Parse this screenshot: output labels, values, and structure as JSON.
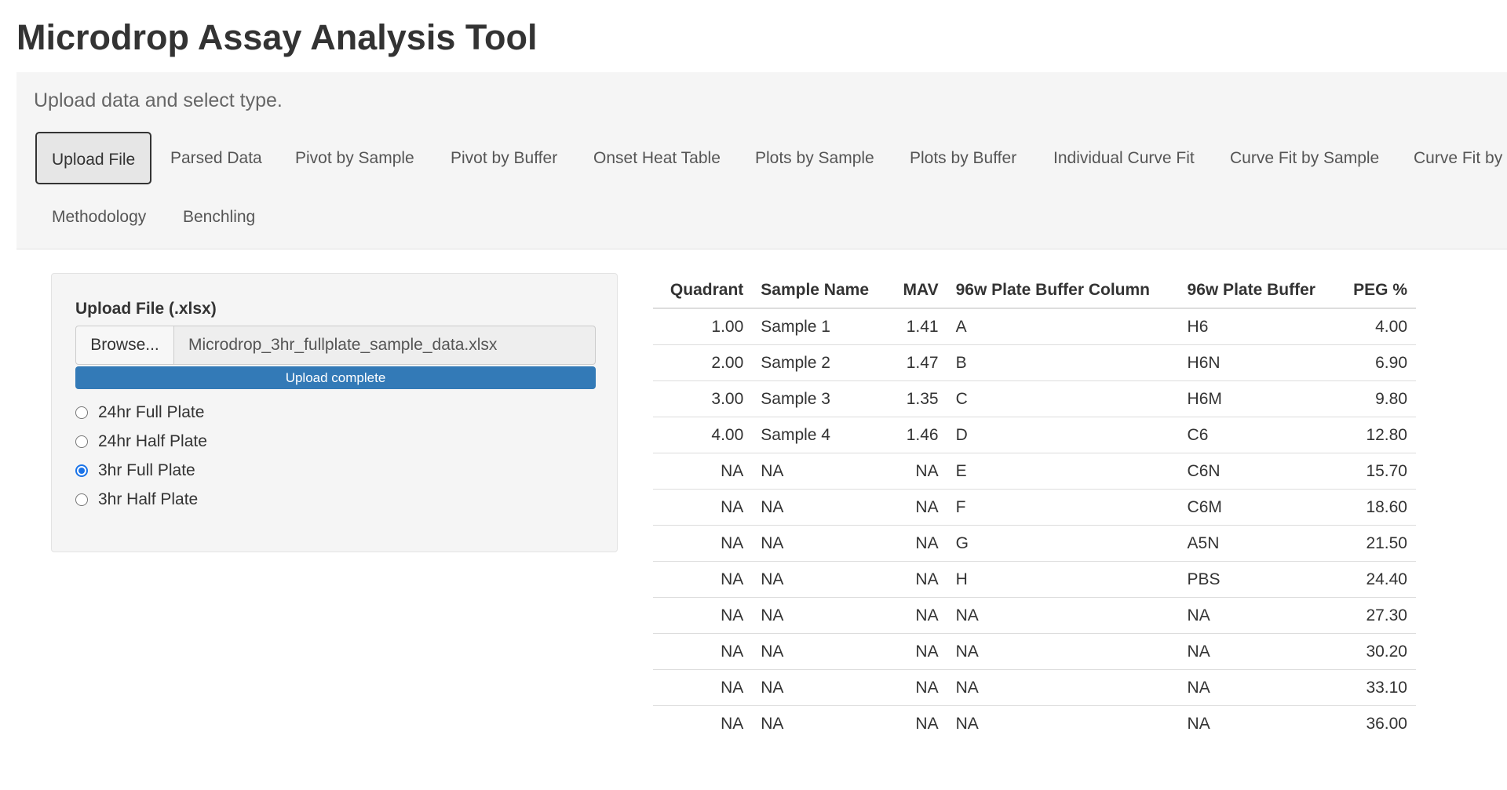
{
  "app": {
    "title": "Microdrop Assay Analysis Tool",
    "subtitle": "Upload data and select type."
  },
  "tabs": [
    {
      "label": "Upload File",
      "active": true
    },
    {
      "label": "Parsed Data"
    },
    {
      "label": "Pivot by Sample"
    },
    {
      "label": "Pivot by Buffer"
    },
    {
      "label": "Onset Heat Table"
    },
    {
      "label": "Plots by Sample"
    },
    {
      "label": "Plots by Buffer"
    },
    {
      "label": "Individual Curve Fit"
    },
    {
      "label": "Curve Fit by Sample"
    },
    {
      "label": "Curve Fit by"
    },
    {
      "label": "Methodology"
    },
    {
      "label": "Benchling"
    }
  ],
  "upload": {
    "label": "Upload File (.xlsx)",
    "browse_label": "Browse...",
    "file_name": "Microdrop_3hr_fullplate_sample_data.xlsx",
    "progress_text": "Upload complete",
    "progress": 1.0
  },
  "plate_types": [
    {
      "label": "24hr Full Plate",
      "checked": false
    },
    {
      "label": "24hr Half Plate",
      "checked": false
    },
    {
      "label": "3hr Full Plate",
      "checked": true
    },
    {
      "label": "3hr Half Plate",
      "checked": false
    }
  ],
  "table": {
    "headers": [
      "Quadrant",
      "Sample Name",
      "MAV",
      "96w Plate Buffer Column",
      "96w Plate Buffer",
      "PEG %"
    ],
    "rows": [
      [
        "1.00",
        "Sample 1",
        "1.41",
        "A",
        "H6",
        "4.00"
      ],
      [
        "2.00",
        "Sample 2",
        "1.47",
        "B",
        "H6N",
        "6.90"
      ],
      [
        "3.00",
        "Sample 3",
        "1.35",
        "C",
        "H6M",
        "9.80"
      ],
      [
        "4.00",
        "Sample 4",
        "1.46",
        "D",
        "C6",
        "12.80"
      ],
      [
        "NA",
        "NA",
        "NA",
        "E",
        "C6N",
        "15.70"
      ],
      [
        "NA",
        "NA",
        "NA",
        "F",
        "C6M",
        "18.60"
      ],
      [
        "NA",
        "NA",
        "NA",
        "G",
        "A5N",
        "21.50"
      ],
      [
        "NA",
        "NA",
        "NA",
        "H",
        "PBS",
        "24.40"
      ],
      [
        "NA",
        "NA",
        "NA",
        "NA",
        "NA",
        "27.30"
      ],
      [
        "NA",
        "NA",
        "NA",
        "NA",
        "NA",
        "30.20"
      ],
      [
        "NA",
        "NA",
        "NA",
        "NA",
        "NA",
        "33.10"
      ],
      [
        "NA",
        "NA",
        "NA",
        "NA",
        "NA",
        "36.00"
      ]
    ]
  }
}
